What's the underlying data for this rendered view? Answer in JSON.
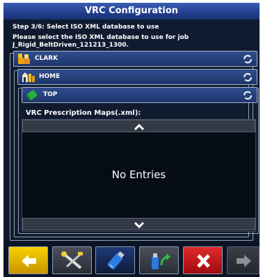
{
  "window": {
    "title": "VRC Configuration"
  },
  "step": {
    "heading": "Step 3/6: Select ISO XML database to use",
    "instruction_line1": "Please select the ISO XML database to use for job",
    "instruction_line2": "J_Rigid_BeltDriven_121213_1300."
  },
  "tree": {
    "level1": {
      "label": "CLARK",
      "icon": "users-icon"
    },
    "level2": {
      "label": "HOME",
      "icon": "farm-icon"
    },
    "level3": {
      "label": "TOP",
      "icon": "field-icon"
    }
  },
  "list": {
    "title": "VRC Prescription Maps(.xml):",
    "empty_message": "No Entries",
    "entries": []
  },
  "toolbar": {
    "buttons": [
      {
        "name": "back-button",
        "icon": "arrow-left-icon",
        "enabled": true
      },
      {
        "name": "tools-button",
        "icon": "crossed-tools-icon",
        "enabled": true
      },
      {
        "name": "usb-drive-button",
        "icon": "usb-drive-icon",
        "enabled": true
      },
      {
        "name": "export-usb-button",
        "icon": "usb-export-icon",
        "enabled": true
      },
      {
        "name": "cancel-button",
        "icon": "close-icon",
        "enabled": true
      },
      {
        "name": "next-button",
        "icon": "arrow-right-icon",
        "enabled": false
      }
    ]
  },
  "colors": {
    "title_bar": "#2a4aa0",
    "background": "#0b1424",
    "row": "#27427c",
    "back_button": "#e8b800",
    "cancel_button": "#c8181c"
  }
}
